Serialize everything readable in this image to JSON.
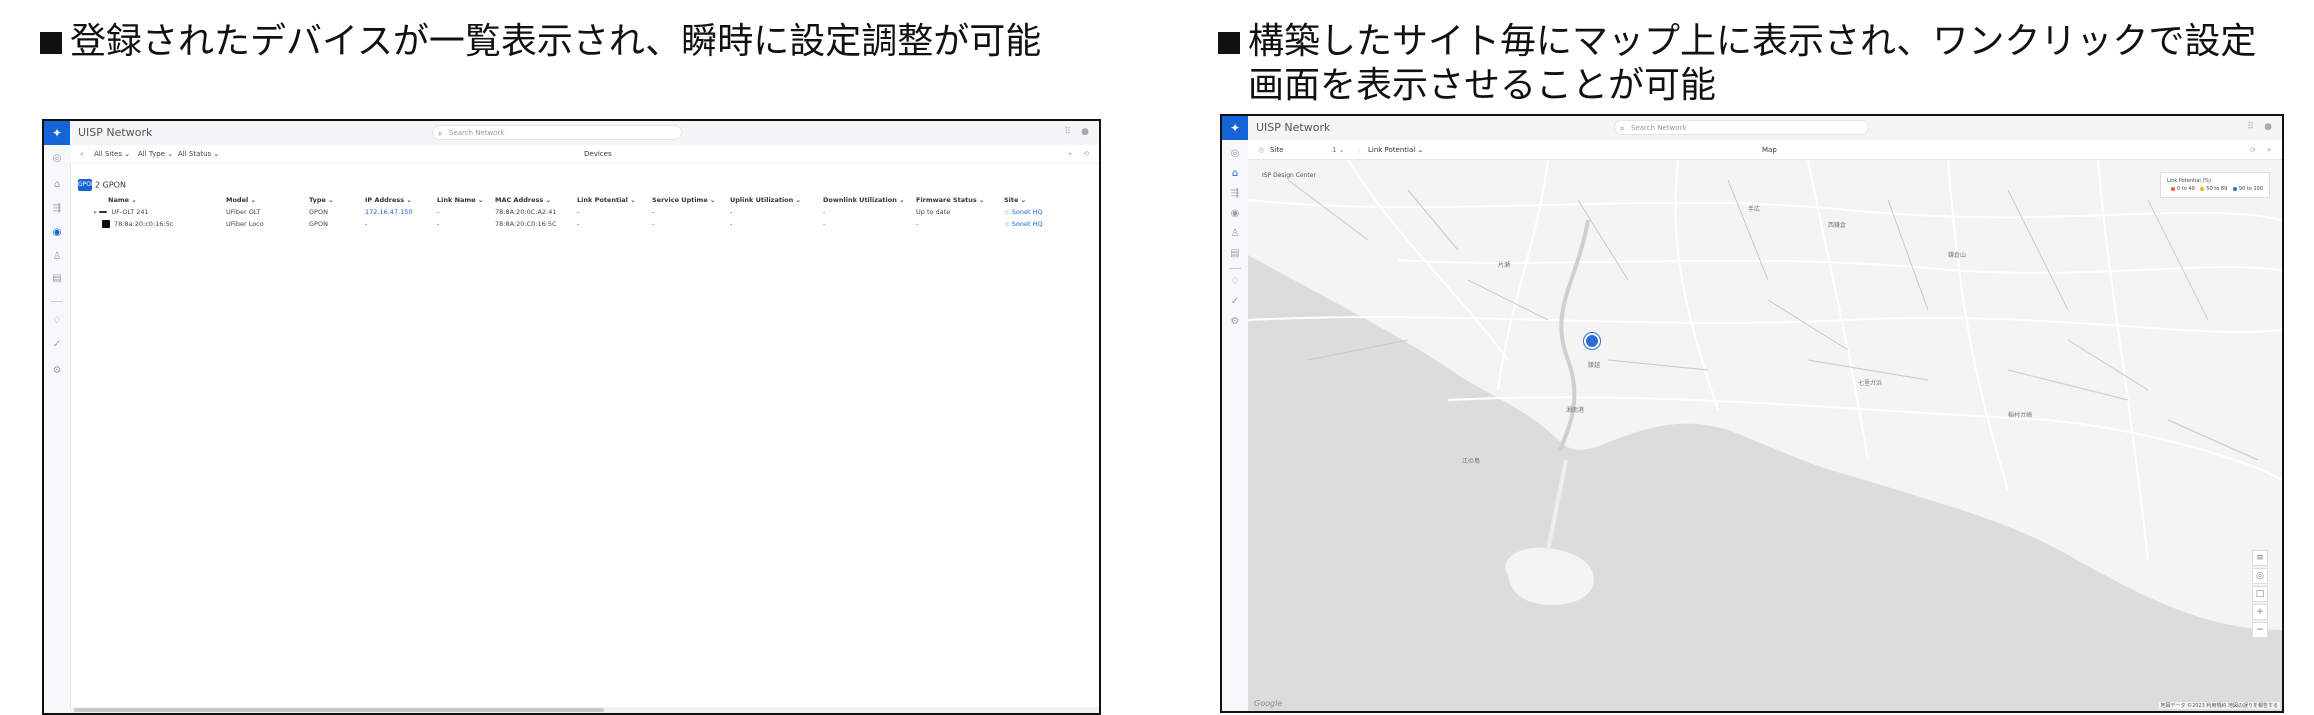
{
  "captions": {
    "left": "登録されたデバイスが一覧表示され、瞬時に設定調整が可能",
    "right_line1": "構築したサイト毎にマップ上に表示され、ワンクリックで設定",
    "right_line2": "画面を表示させることが可能"
  },
  "left_screen": {
    "app_title": "UISP Network",
    "search_placeholder": "Search Network",
    "filters": {
      "sites": "All Sites ⌄",
      "type": "All Type ⌄",
      "status": "All Status ⌄"
    },
    "page_title": "Devices",
    "group": {
      "badge": "GPON",
      "label": "2 GPON"
    },
    "columns": [
      "Name ⌄",
      "Model ⌄",
      "Type ⌄",
      "IP Address ⌄",
      "Link Name ⌄",
      "MAC Address ⌄",
      "Link Potential ⌄",
      "Service Uptime ⌄",
      "Uplink Utilization ⌄",
      "Downlink Utilization ⌄",
      "Firmware Status ⌄",
      "Site ⌄"
    ],
    "rows": [
      [
        "UF-OLT 241",
        "UFiber OLT",
        "GPON",
        "172.16.47.150",
        "-",
        "78:8A:20:0C:A2:41",
        "-",
        "-",
        "-",
        "-",
        "Up to date",
        "Sonet HQ"
      ],
      [
        "78:8a:20:c0:16:5c",
        "UFiber Loco",
        "GPON",
        "-",
        "-",
        "78:8A:20:C0:16:5C",
        "-",
        "-",
        "-",
        "-",
        "-",
        "Sonet HQ"
      ]
    ]
  },
  "right_screen": {
    "app_title": "UISP Network",
    "search_placeholder": "Search Network",
    "site_selector": "Site",
    "site_count": "1 ⌄",
    "overlay_selector": "Link Potential ⌄",
    "page_title": "Map",
    "site_label": "ISP Design Center",
    "legend_title": "Link Potential (%)",
    "legend_items": [
      {
        "label": "0 to 49",
        "color": "#e85c4a"
      },
      {
        "label": "50 to 89",
        "color": "#f0b429"
      },
      {
        "label": "90 to 100",
        "color": "#2b6fd6"
      }
    ],
    "place_labels": [
      "腰越",
      "江の島",
      "七里ガ浜",
      "稲村ガ崎",
      "鎌倉山",
      "西鎌倉",
      "手広",
      "片瀬",
      "湘南港"
    ],
    "attribution": "地図データ ©2023   利用規約   地図の誤りを報告する",
    "google": "Google"
  },
  "icons": {
    "logo": "uisp-logo-icon",
    "nav": [
      "dashboard-icon",
      "sites-icon",
      "devices-icon",
      "map-icon",
      "users-icon",
      "inventory-icon",
      "notifications-icon",
      "tasks-icon",
      "settings-icon"
    ]
  }
}
